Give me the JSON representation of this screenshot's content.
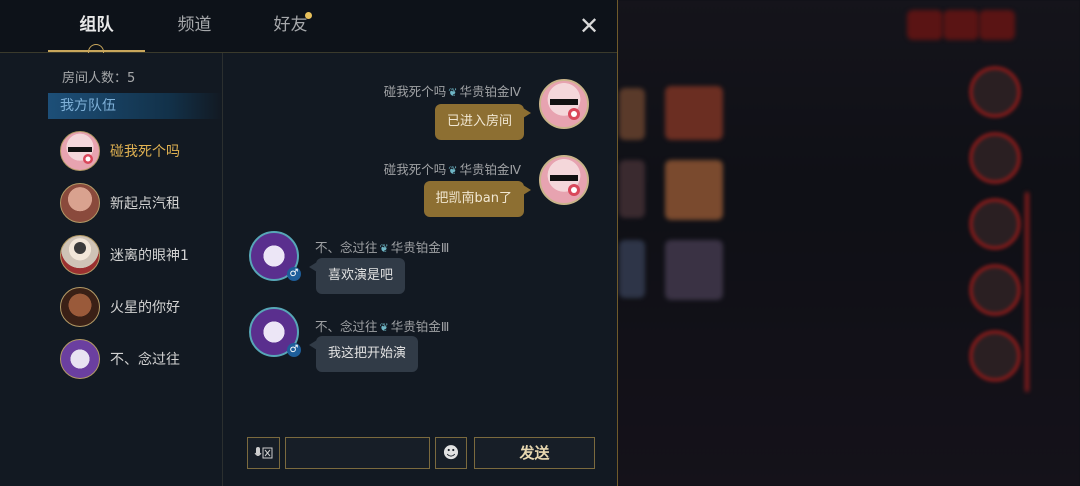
{
  "tabs": [
    {
      "label": "组队"
    },
    {
      "label": "频道"
    },
    {
      "label": "好友"
    }
  ],
  "room_count": "房间人数：5",
  "team_header": "我方队伍",
  "members": [
    {
      "name": "碰我死个吗",
      "highlight": true
    },
    {
      "name": "新起点汽租",
      "highlight": false
    },
    {
      "name": "迷离的眼神1",
      "highlight": false
    },
    {
      "name": "火星的你好",
      "highlight": false
    },
    {
      "name": "不、念过往",
      "highlight": false
    }
  ],
  "messages": [
    {
      "sender": "碰我死个吗",
      "rank": "华贵铂金Ⅳ",
      "text": "已进入房间",
      "mine": true
    },
    {
      "sender": "碰我死个吗",
      "rank": "华贵铂金Ⅳ",
      "text": "把凯南ban了",
      "mine": true
    },
    {
      "sender": "不、念过往",
      "rank": "华贵铂金Ⅲ",
      "text": "喜欢演是吧",
      "mine": false
    },
    {
      "sender": "不、念过往",
      "rank": "华贵铂金Ⅲ",
      "text": "我这把开始演",
      "mine": false
    }
  ],
  "input": {
    "value": "",
    "placeholder": ""
  },
  "send_label": "发送",
  "close_label": "✕",
  "side_id": "9066005",
  "colors": {
    "accent_gold": "#c9a75c",
    "my_bubble": "#8d6f32",
    "other_bubble": "#313b47",
    "team_header": "#1d4f78"
  }
}
